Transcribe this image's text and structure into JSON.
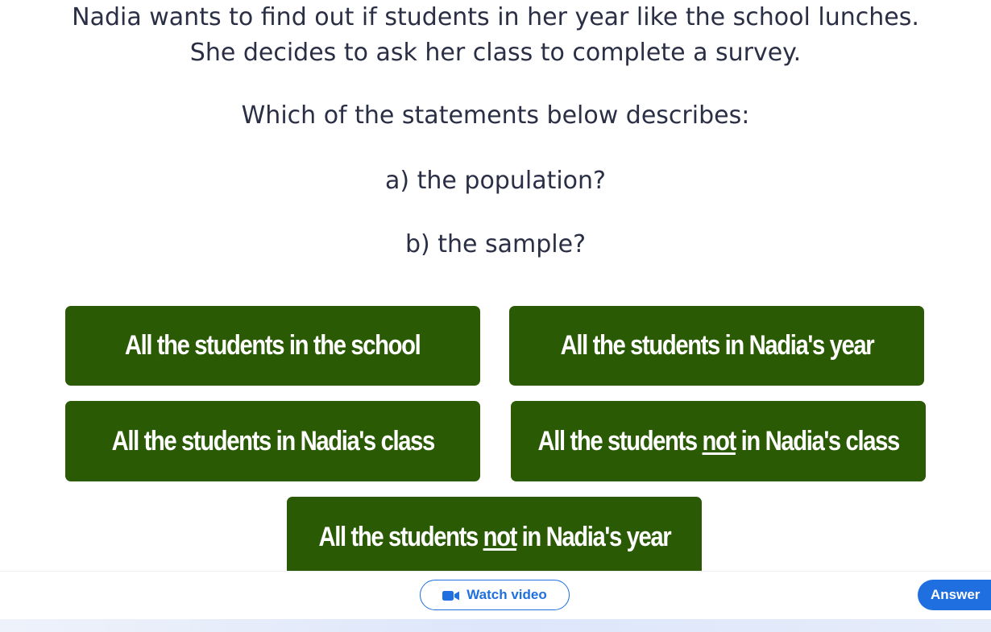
{
  "question": {
    "line1": "Nadia wants to find out if students in her year like the school lunches.",
    "line2": "She decides to ask her class to complete a survey.",
    "line3": "Which of the statements below describes:",
    "line4": "a) the population?",
    "line5": "b) the sample?"
  },
  "options": {
    "opt1": "All the students in the school",
    "opt2": "All the students in Nadia's year",
    "opt3": "All the students in Nadia's class",
    "opt4": {
      "before": "All the students ",
      "emph": "not",
      "after": " in Nadia's class"
    },
    "opt5": {
      "before": "All the students ",
      "emph": "not",
      "after": " in Nadia's year"
    }
  },
  "colors": {
    "option_bg": "#2a5b04",
    "accent": "#1f6fe0",
    "text": "#2b2f45"
  },
  "footer": {
    "watch_video_label": "Watch video",
    "watch_video_icon": "video-camera-icon",
    "answer_label": "Answer"
  }
}
